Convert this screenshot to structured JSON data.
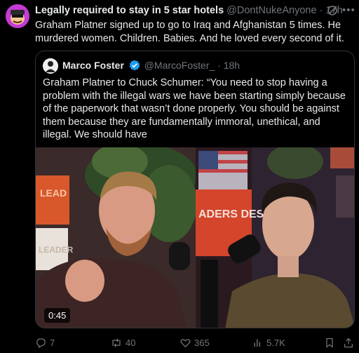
{
  "author": {
    "display_name": "Legally required to stay in 5 star hotels",
    "handle": "@DontNukeAnyone",
    "separator": "·",
    "time": "17h"
  },
  "tweet": {
    "text": "Graham Platner signed up to go to Iraq and Afghanistan 5 times. He murdered women. Children. Babies. And he loved every second of it."
  },
  "quote": {
    "display_name": "Marco Foster",
    "handle": "@MarcoFoster_",
    "separator": "·",
    "time": "18h",
    "text": "Graham Platner to Chuck Schumer: “You need to stop having a problem with the illegal wars we have been starting simply because of the paperwork that wasn’t done properly. You should be against them because they are fundamentally immoral, unethical, and illegal. We should have",
    "media": {
      "duration": "0:45",
      "sign_left_top": "LEAD",
      "sign_left_bottom": "LEADER",
      "sign_center": "ADERS DESERVE"
    }
  },
  "actions": {
    "replies": "7",
    "reposts": "40",
    "likes": "365",
    "views": "5.7K"
  },
  "colors": {
    "background": "#000000",
    "text": "#e7e9ea",
    "muted": "#71767b",
    "border": "#2f3336",
    "verified": "#1d9bf0",
    "avatar": "#c43bd6"
  },
  "icons": [
    "grok-icon",
    "more-icon",
    "verified-badge-icon",
    "reply-icon",
    "repost-icon",
    "like-icon",
    "views-icon",
    "bookmark-icon",
    "share-icon"
  ]
}
